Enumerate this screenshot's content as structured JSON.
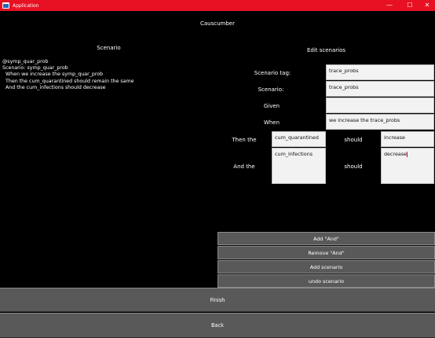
{
  "window": {
    "title": "Application",
    "minimize_glyph": "—",
    "maximize_glyph": "☐",
    "close_glyph": "✕"
  },
  "header": {
    "app_name": "Causcumber"
  },
  "scenario_panel": {
    "heading": "Scenario",
    "text": "@symp_quar_prob\nScenario: symp_quar_prob\n  When we increase the symp_quar_prob\n  Then the cum_quarantined should remain the same\n  And the cum_infections should decrease"
  },
  "edit_panel": {
    "heading": "Edit scenarios",
    "scenario_tag_label": "Scenario tag:",
    "scenario_tag_value": "trace_probs",
    "scenario_label": "Scenario:",
    "scenario_value": "trace_probs",
    "given_label": "Given",
    "given_value": "",
    "when_label": "When",
    "when_value": "we increase the trace_probs",
    "then_label": "Then the",
    "then_variable": "cum_quarantined",
    "then_should": "should",
    "then_change": "increase",
    "and_label": "And the",
    "and_variable": "cum_infections",
    "and_should": "should",
    "and_change": "decrease"
  },
  "actions": {
    "add_and": "Add \"And\"",
    "remove_and": "Remove \"And\"",
    "add_scenario": "Add scenario",
    "undo_scenario": "undo scenario",
    "finish": "Finish",
    "back": "Back"
  },
  "colors": {
    "titlebar": "#e81123",
    "background": "#000000",
    "button": "#595959",
    "field": "#f2f2f2"
  }
}
